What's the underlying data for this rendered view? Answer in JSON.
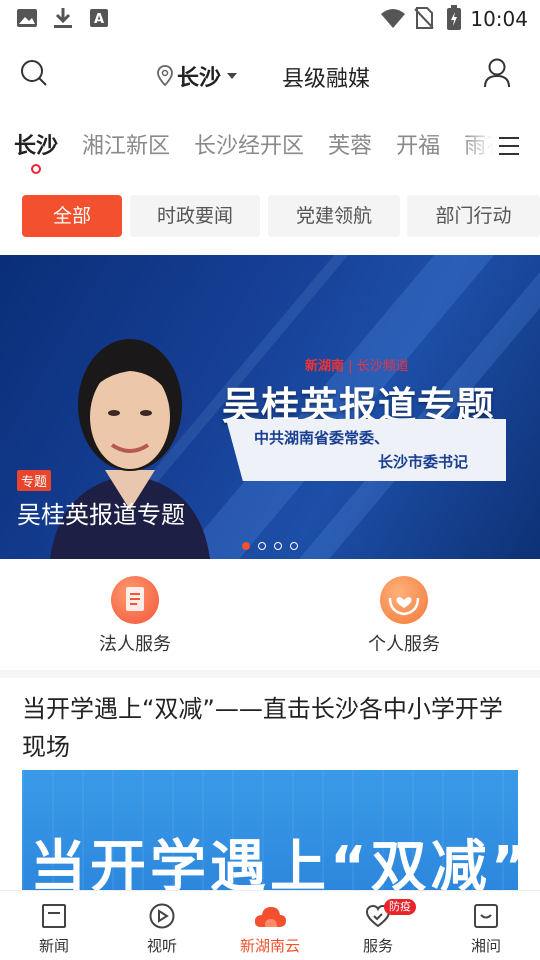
{
  "status": {
    "time": "10:04"
  },
  "header": {
    "location": "长沙",
    "title": "县级融媒"
  },
  "channels": [
    "长沙",
    "湘江新区",
    "长沙经开区",
    "芙蓉",
    "开福",
    "雨花"
  ],
  "subtabs": [
    "全部",
    "时政要闻",
    "党建领航",
    "部门行动"
  ],
  "banner": {
    "brand": "新湖南",
    "brand_sub": "长沙频道",
    "headline": "吴桂英报道专题",
    "line1": "中共湖南省委常委、",
    "line2": "长沙市委书记",
    "tag": "专题",
    "caption": "吴桂英报道专题",
    "slide_count": 4,
    "active_slide": 1
  },
  "services": [
    {
      "label": "法人服务",
      "icon": "document-icon",
      "color": "#f2553a"
    },
    {
      "label": "个人服务",
      "icon": "heart-hands-icon",
      "color": "#f27a3a"
    }
  ],
  "news": {
    "title": "当开学遇上“双减”——直击长沙各中小学开学现场",
    "image_text": "当开学遇上“双减”"
  },
  "tabbar": [
    {
      "label": "新闻",
      "icon": "news-icon"
    },
    {
      "label": "视听",
      "icon": "play-icon"
    },
    {
      "label": "新湖南云",
      "icon": "cloud-icon",
      "active": true
    },
    {
      "label": "服务",
      "icon": "heart-icon",
      "badge": "防疫"
    },
    {
      "label": "湘问",
      "icon": "message-icon"
    }
  ],
  "colors": {
    "accent": "#f2502e",
    "badge": "#e8242c"
  }
}
